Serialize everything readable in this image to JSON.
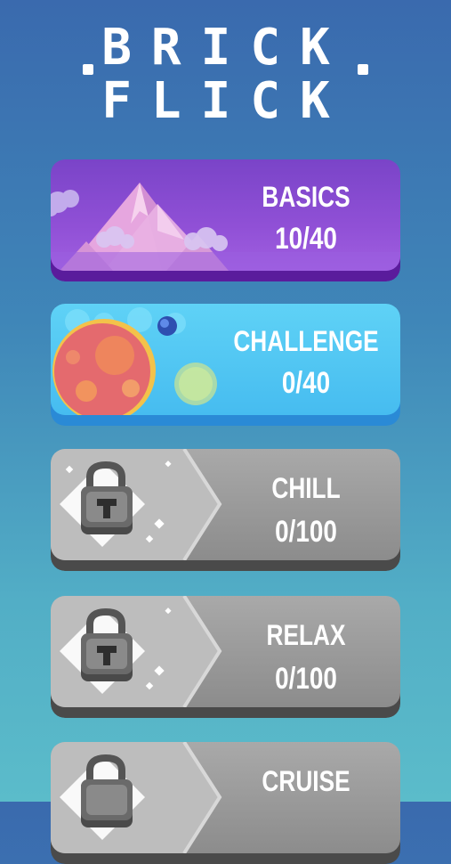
{
  "logo": {
    "line1": "BRICK",
    "line2": "FLICK"
  },
  "levels": [
    {
      "title": "BASICS",
      "progress": "10/40",
      "theme": "mountains",
      "locked": false
    },
    {
      "title": "CHALLENGE",
      "progress": "0/40",
      "theme": "planets",
      "locked": false
    },
    {
      "title": "CHILL",
      "progress": "0/100",
      "locked": true
    },
    {
      "title": "RELAX",
      "progress": "0/100",
      "locked": true
    },
    {
      "title": "CRUISE",
      "progress": "",
      "locked": true
    }
  ],
  "colors": {
    "background_top": "#3a6aae",
    "background_bottom": "#5bbcca",
    "basics": "#8a4ad2",
    "challenge": "#4cc6f2",
    "locked": "#9a9a9a"
  }
}
